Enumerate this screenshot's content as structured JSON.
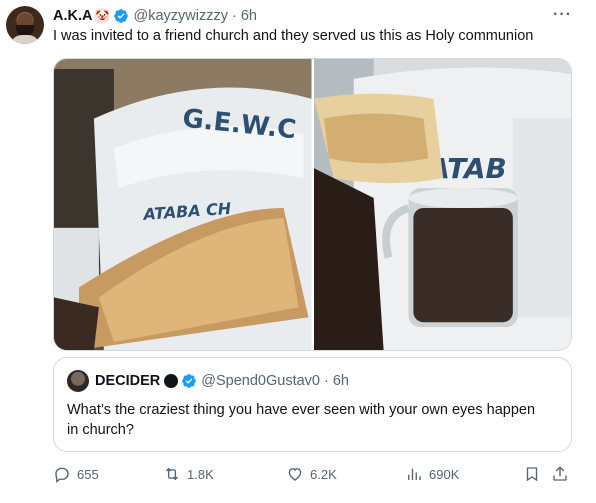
{
  "tweet": {
    "display_name": "A.K.A",
    "emoji": "🤡",
    "handle": "@kayzywizzzy",
    "separator": "·",
    "time": "6h",
    "more": "···",
    "text": "I was invited to a friend church and they served us this as Holy communion"
  },
  "media": {
    "photo1_label": "Bread held in front of a plastic chair",
    "photo2_label": "Bread and cup of drink",
    "chair_text_top": "G.E.W.C",
    "chair_text_left": "ATABA CH",
    "chair_text_right": "ATAB"
  },
  "quote": {
    "display_name": "DECIDER",
    "handle": "@Spend0Gustav0",
    "separator": "·",
    "time": "6h",
    "text": "What’s the craziest thing you have  ever seen with your own eyes happen in church?"
  },
  "actions": {
    "replies": "655",
    "reposts": "1.8K",
    "likes": "6.2K",
    "views": "690K"
  },
  "colors": {
    "text": "#0f1419",
    "secondary": "#536471",
    "verified": "#1d9bf0",
    "border": "#cfd9de"
  },
  "icons": [
    "reply-icon",
    "repost-icon",
    "like-icon",
    "views-icon",
    "bookmark-icon",
    "share-icon",
    "verified-icon",
    "more-icon"
  ]
}
